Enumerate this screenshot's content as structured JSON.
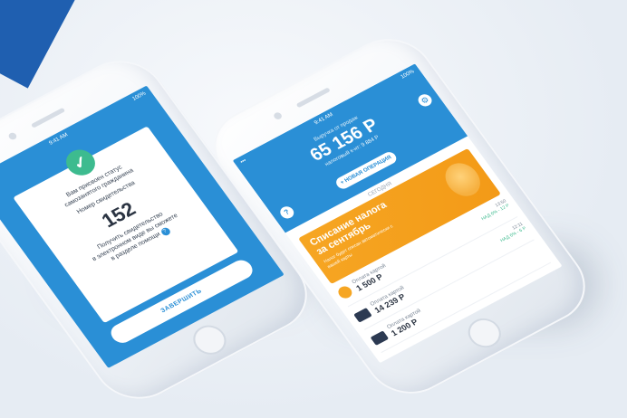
{
  "phone1": {
    "status_time": "9:41 AM",
    "status_battery": "100%",
    "status_signal": "•••",
    "message_line1": "Вам присвоен статус",
    "message_line2": "самозанятого гражданина",
    "certificate_label": "Номер свидетельства",
    "certificate_number": "152",
    "info_line1": "Получить свидетельство",
    "info_line2": "в электронном виде вы сможете",
    "info_line3": "в разделе помощи",
    "help_glyph": "?",
    "finish_label": "ЗАВЕРШИТЬ"
  },
  "phone2": {
    "status_time": "9:41 AM",
    "status_battery": "100%",
    "status_signal": "•••",
    "revenue_label": "Выручка от продаж",
    "revenue_value": "65 156 Р",
    "tax_label": "налоговый к-нт: 9 884 Р",
    "new_op_label": "+ НОВАЯ ОПЕРАЦИЯ",
    "help_glyph": "?",
    "section_label": "СЕГОДНЯ",
    "promo_title": "Списание налога за сентябрь",
    "promo_sub": "Налог будет списан автоматически с вашей карты",
    "promo_time": "18:30",
    "promo_tax": "НАД 6% - 12 Р",
    "rows": [
      {
        "label": "Оплата картой",
        "amount": "1 500 Р",
        "time": "13:50",
        "tax": "НАД 6% - 12 Р"
      },
      {
        "label": "Оплата картой",
        "amount": "14 239 Р",
        "time": "12:11",
        "tax": "НАД 6% - 6 Р"
      },
      {
        "label": "Оплата картой",
        "amount": "1 200 Р",
        "time": "",
        "tax": ""
      }
    ],
    "colors": {
      "primary": "#2a8fd6",
      "accent": "#f6a623",
      "success": "#3dbb8f"
    }
  }
}
